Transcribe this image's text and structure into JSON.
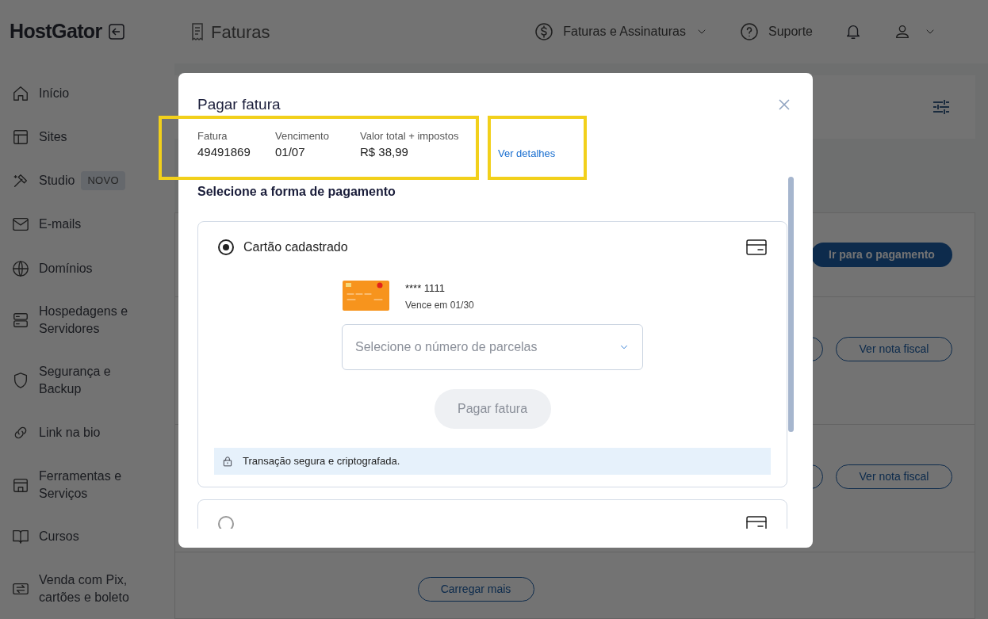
{
  "app": {
    "logo": "HostGator",
    "page_title": "Faturas"
  },
  "header_nav": [
    {
      "kind": "menu",
      "label": "Faturas e Assinaturas"
    },
    {
      "kind": "link",
      "label": "Suporte"
    }
  ],
  "sidebar": {
    "items": [
      {
        "label": "Início"
      },
      {
        "label": "Sites"
      },
      {
        "label": "Studio",
        "badge": "NOVO"
      },
      {
        "label": "E-mails"
      },
      {
        "label": "Domínios"
      },
      {
        "label": "Hospedagens e Servidores"
      },
      {
        "label": "Segurança e Backup"
      },
      {
        "label": "Link na bio"
      },
      {
        "label": "Ferramentas e Serviços"
      },
      {
        "label": "Cursos"
      },
      {
        "label": "Venda com Pix, cartões e boleto"
      }
    ]
  },
  "background_list": {
    "primary_button": "Ir para o pagamento",
    "rows": [
      {
        "button": "Ver nota fiscal"
      },
      {
        "button": "Ver nota fiscal"
      }
    ],
    "load_more": "Carregar mais"
  },
  "modal": {
    "title": "Pagar fatura",
    "summary": [
      {
        "label": "Fatura",
        "value": "49491869"
      },
      {
        "label": "Vencimento",
        "value": "01/07"
      },
      {
        "label": "Valor total + impostos",
        "value": "R$ 38,99"
      }
    ],
    "details_link": "Ver detalhes",
    "section_title": "Selecione a forma de pagamento",
    "options": [
      {
        "label": "Cartão cadastrado",
        "selected": true,
        "card": {
          "number": "**** 1111",
          "expiry": "Vence em 01/30"
        },
        "installments": {
          "placeholder": "Selecione o número de parcelas"
        },
        "pay_button": {
          "label": "Pagar fatura",
          "disabled": true
        },
        "security_note": "Transação segura e criptografada."
      },
      {
        "selected": false
      }
    ]
  }
}
